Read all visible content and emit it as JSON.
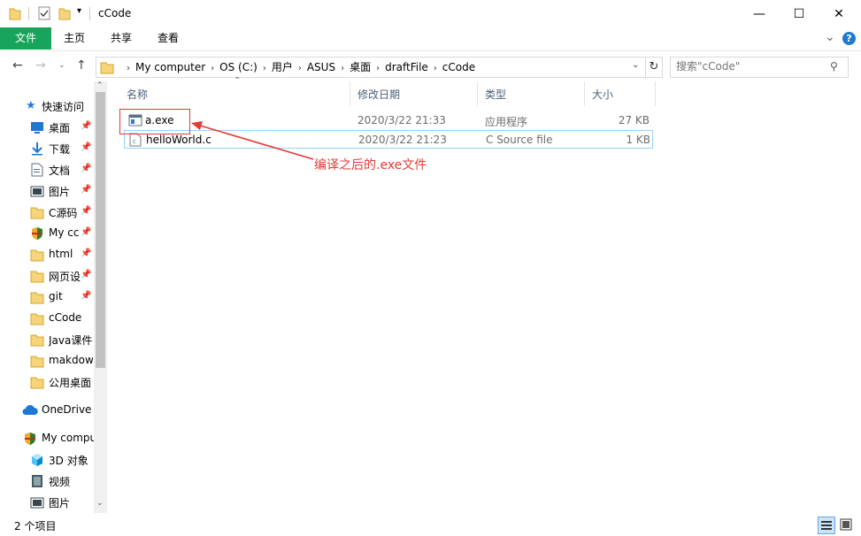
{
  "window": {
    "title": "cCode",
    "minimize_glyph": "—",
    "maximize_glyph": "☐",
    "close_glyph": "✕"
  },
  "ribbon": {
    "tabs": [
      "文件",
      "主页",
      "共享",
      "查看"
    ],
    "expand_glyph": "⌄",
    "help_glyph": "?"
  },
  "address": {
    "breadcrumbs": [
      "My computer",
      "OS (C:)",
      "用户",
      "ASUS",
      "桌面",
      "draftFile",
      "cCode"
    ]
  },
  "search": {
    "placeholder": "搜索\"cCode\""
  },
  "sidebar": {
    "quick_access_label": "快速访问",
    "items": [
      {
        "label": "桌面",
        "icon": "desktop-icon",
        "pinned": true
      },
      {
        "label": "下载",
        "icon": "download-icon",
        "pinned": true
      },
      {
        "label": "文档",
        "icon": "document-icon",
        "pinned": true
      },
      {
        "label": "图片",
        "icon": "picture-icon",
        "pinned": true
      },
      {
        "label": "C源码",
        "icon": "folder-icon",
        "pinned": true
      },
      {
        "label": "My cc",
        "icon": "shield-icon",
        "pinned": true
      },
      {
        "label": "html",
        "icon": "folder-icon",
        "pinned": true
      },
      {
        "label": "网页设",
        "icon": "folder-icon",
        "pinned": true
      },
      {
        "label": "git",
        "icon": "folder-icon",
        "pinned": true
      },
      {
        "label": "cCode",
        "icon": "folder-icon",
        "pinned": false
      },
      {
        "label": "Java课件",
        "icon": "folder-icon",
        "pinned": false
      },
      {
        "label": "makdow",
        "icon": "folder-icon",
        "pinned": false
      },
      {
        "label": "公用桌面",
        "icon": "folder-icon",
        "pinned": false
      }
    ],
    "onedrive_label": "OneDrive",
    "computer_label": "My compu",
    "computer_items": [
      {
        "label": "3D 对象",
        "icon": "cube-icon"
      },
      {
        "label": "视频",
        "icon": "video-icon"
      },
      {
        "label": "图片",
        "icon": "picture-icon"
      }
    ]
  },
  "filelist": {
    "columns": [
      "名称",
      "修改日期",
      "类型",
      "大小"
    ],
    "rows": [
      {
        "name": "a.exe",
        "modified": "2020/3/22 21:33",
        "type": "应用程序",
        "size": "27 KB",
        "icon": "exe-icon"
      },
      {
        "name": "helloWorld.c",
        "modified": "2020/3/22 21:23",
        "type": "C Source file",
        "size": "1 KB",
        "icon": "c-file-icon"
      }
    ]
  },
  "annotation": {
    "text": "编译之后的.exe文件",
    "color": "#e53935"
  },
  "status": {
    "item_count": "2 个项目"
  },
  "colors": {
    "file_tab": "#19a45b",
    "selection_border": "#99d1ff",
    "annotation": "#e53935"
  }
}
